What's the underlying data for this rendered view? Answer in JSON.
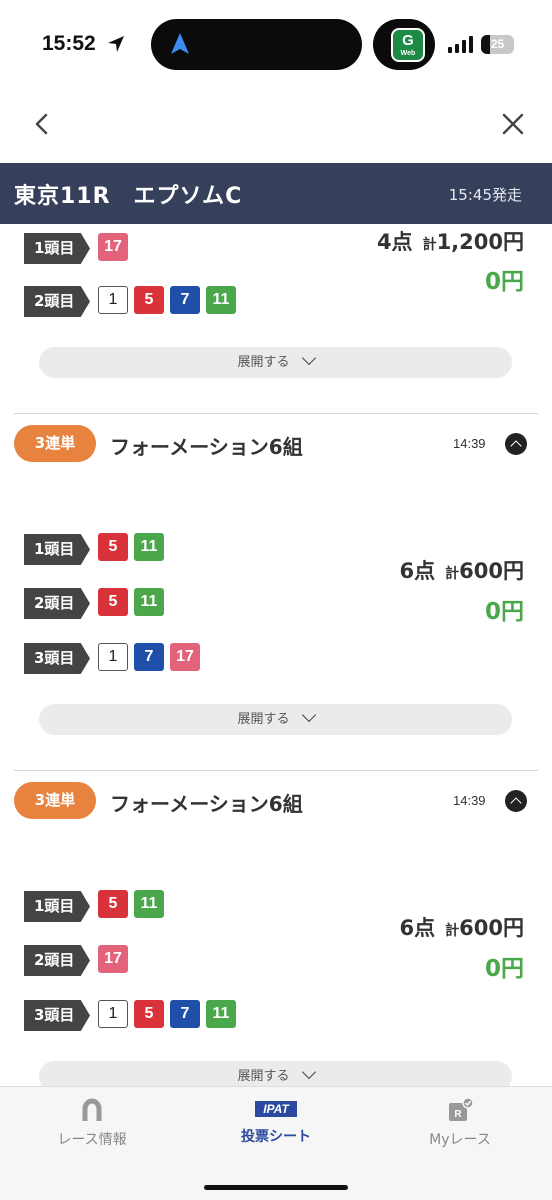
{
  "status": {
    "time": "15:52",
    "battery": "25"
  },
  "app_badge": {
    "letter": "G",
    "sub": "Web"
  },
  "race": {
    "title": "東京11R　エプソムC",
    "post_time": "15:45発走"
  },
  "tickets": [
    {
      "rows": [
        {
          "label": "1頭目",
          "horses": [
            {
              "n": "17",
              "c": "pink"
            }
          ]
        },
        {
          "label": "2頭目",
          "horses": [
            {
              "n": "1",
              "c": "white"
            },
            {
              "n": "5",
              "c": "red"
            },
            {
              "n": "7",
              "c": "blue"
            },
            {
              "n": "11",
              "c": "green"
            }
          ]
        }
      ],
      "points": "4点",
      "total_label": "計",
      "total": "1,200円",
      "payout": "0円",
      "expand_label": "展開する"
    },
    {
      "bet_type": "3連単",
      "name": "フォーメーション6組",
      "time": "14:39",
      "rows": [
        {
          "label": "1頭目",
          "horses": [
            {
              "n": "5",
              "c": "red"
            },
            {
              "n": "11",
              "c": "green"
            }
          ]
        },
        {
          "label": "2頭目",
          "horses": [
            {
              "n": "5",
              "c": "red"
            },
            {
              "n": "11",
              "c": "green"
            }
          ]
        },
        {
          "label": "3頭目",
          "horses": [
            {
              "n": "1",
              "c": "white"
            },
            {
              "n": "7",
              "c": "blue"
            },
            {
              "n": "17",
              "c": "pink"
            }
          ]
        }
      ],
      "points": "6点",
      "total_label": "計",
      "total": "600円",
      "payout": "0円",
      "expand_label": "展開する"
    },
    {
      "bet_type": "3連単",
      "name": "フォーメーション6組",
      "time": "14:39",
      "rows": [
        {
          "label": "1頭目",
          "horses": [
            {
              "n": "5",
              "c": "red"
            },
            {
              "n": "11",
              "c": "green"
            }
          ]
        },
        {
          "label": "2頭目",
          "horses": [
            {
              "n": "17",
              "c": "pink"
            }
          ]
        },
        {
          "label": "3頭目",
          "horses": [
            {
              "n": "1",
              "c": "white"
            },
            {
              "n": "5",
              "c": "red"
            },
            {
              "n": "7",
              "c": "blue"
            },
            {
              "n": "11",
              "c": "green"
            }
          ]
        }
      ],
      "points": "6点",
      "total_label": "計",
      "total": "600円",
      "payout": "0円",
      "expand_label": "展開する"
    }
  ],
  "tabs": [
    {
      "label": "レース情報",
      "icon": "horseshoe-icon",
      "active": false
    },
    {
      "label": "投票シート",
      "badge": "IPAT",
      "icon": "ipat-icon",
      "active": true
    },
    {
      "label": "Myレース",
      "badge": "R",
      "icon": "my-race-icon",
      "active": false
    }
  ],
  "colors": {
    "banner": "#36405b",
    "bet_type": "#e8823f",
    "payout": "#4aa84a",
    "tab_active": "#2b4a9f"
  }
}
